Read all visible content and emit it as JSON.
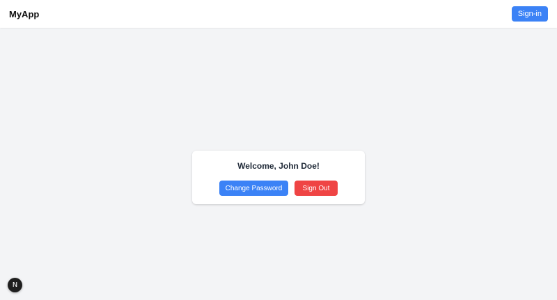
{
  "navbar": {
    "brand": "MyApp",
    "signin_label": "Sign-in"
  },
  "card": {
    "welcome_text": "Welcome, John Doe!",
    "change_password_label": "Change Password",
    "sign_out_label": "Sign Out"
  },
  "dev_badge": {
    "icon": "nextjs-logo-icon",
    "letter": "N"
  },
  "colors": {
    "primary": "#3b82f6",
    "danger": "#ef4444",
    "background": "#f3f4f6"
  }
}
